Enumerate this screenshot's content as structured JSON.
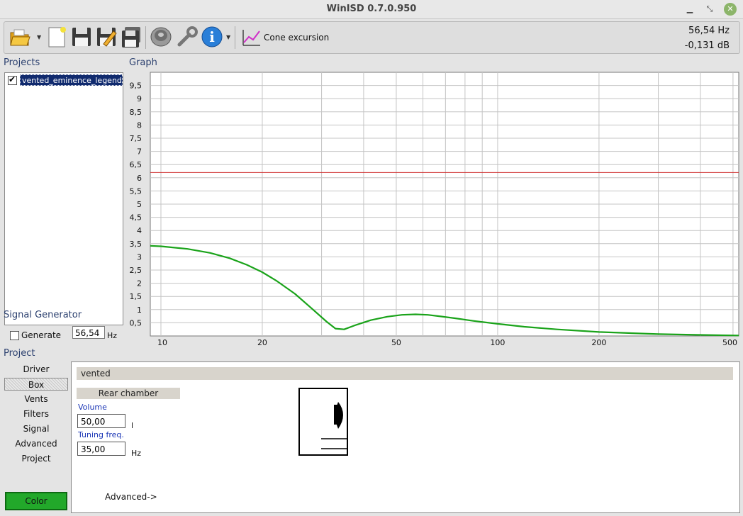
{
  "window": {
    "title": "WinISD 0.7.0.950",
    "controls": [
      "minimize",
      "maximize",
      "close"
    ]
  },
  "toolbar": {
    "icons": [
      "open-folder-icon",
      "new-document-icon",
      "save-icon",
      "save-as-icon",
      "save-all-icon",
      "driver-icon",
      "tools-icon",
      "info-icon",
      "cone-excursion-icon"
    ],
    "cone_label": "Cone excursion",
    "readout_freq": "56,54 Hz",
    "readout_db": "-0,131 dB"
  },
  "projects": {
    "label": "Projects",
    "items": [
      {
        "name": "vented_eminence_legend_bp",
        "checked": true,
        "selected": true
      }
    ]
  },
  "graph": {
    "label": "Graph"
  },
  "signal_generator": {
    "label": "Signal Generator",
    "generate_label": "Generate",
    "generate_checked": false,
    "frequency": "56,54",
    "unit": "Hz"
  },
  "project": {
    "label": "Project",
    "nav": [
      "Driver",
      "Box",
      "Vents",
      "Filters",
      "Signal",
      "Advanced",
      "Project"
    ],
    "active_nav": "Box",
    "color_button": "Color",
    "color": "#22a82a"
  },
  "box_panel": {
    "header": "vented",
    "rear_chamber": "Rear chamber",
    "volume_label": "Volume",
    "volume_value": "50,00",
    "volume_unit": "l",
    "tuning_label": "Tuning freq.",
    "tuning_value": "35,00",
    "tuning_unit": "Hz",
    "advanced": "Advanced->"
  },
  "chart_data": {
    "type": "line",
    "title": "",
    "xlabel": "",
    "ylabel": "",
    "x_scale": "log",
    "xlim": [
      9.3,
      520
    ],
    "ylim": [
      0,
      10
    ],
    "grid": true,
    "x_ticks": [
      "10",
      "20",
      "50",
      "100",
      "200",
      "500"
    ],
    "x_tick_values": [
      10,
      20,
      50,
      100,
      200,
      500
    ],
    "y_ticks": [
      "0,5",
      "1",
      "1,5",
      "2",
      "2,5",
      "3",
      "3,5",
      "4",
      "4,5",
      "5",
      "5,5",
      "6",
      "6,5",
      "7",
      "7,5",
      "8",
      "8,5",
      "9",
      "9,5"
    ],
    "y_tick_values": [
      0.5,
      1,
      1.5,
      2,
      2.5,
      3,
      3.5,
      4,
      4.5,
      5,
      5.5,
      6,
      6.5,
      7,
      7.5,
      8,
      8.5,
      9,
      9.5
    ],
    "series": [
      {
        "color": "#1aa31a",
        "x": [
          9.3,
          10,
          12,
          14,
          16,
          18,
          20,
          22,
          25,
          28,
          31,
          33,
          35,
          38,
          42,
          47,
          52,
          57,
          62,
          68,
          75,
          85,
          100,
          120,
          150,
          200,
          300,
          400,
          520
        ],
        "y": [
          3.42,
          3.4,
          3.3,
          3.15,
          2.95,
          2.7,
          2.42,
          2.1,
          1.6,
          1.05,
          0.55,
          0.28,
          0.25,
          0.42,
          0.6,
          0.73,
          0.8,
          0.82,
          0.8,
          0.74,
          0.67,
          0.57,
          0.46,
          0.35,
          0.25,
          0.15,
          0.07,
          0.04,
          0.02
        ]
      },
      {
        "color": "#d03030",
        "x": [
          9.3,
          520
        ],
        "y": [
          6.2,
          6.2
        ]
      }
    ]
  }
}
